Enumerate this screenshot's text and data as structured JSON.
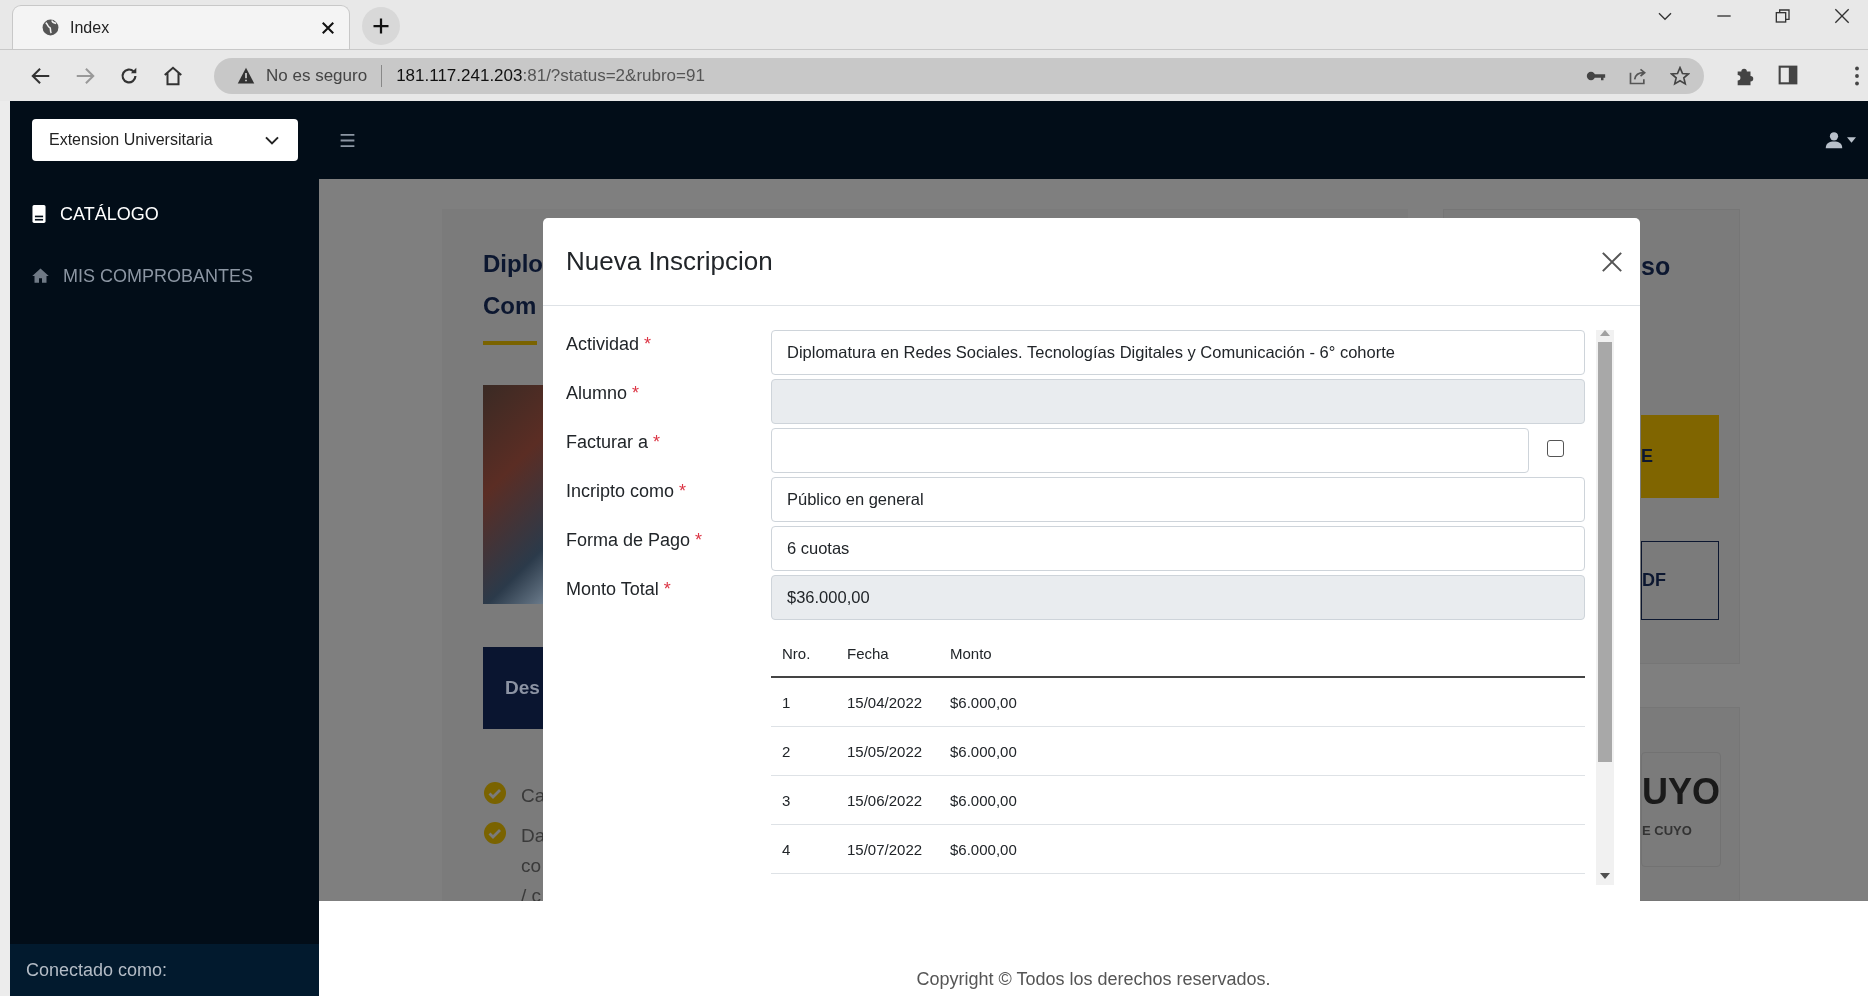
{
  "browser": {
    "tabs": [
      {
        "title": "Index",
        "selected": true
      }
    ],
    "security": "No es seguro",
    "url_host": "181.117.241.203",
    "url_rest": ":81/?status=2&rubro=91"
  },
  "sidebar": {
    "dropdown": "Extension Universitaria",
    "items": [
      {
        "label": "CATÁLOGO",
        "kind": "book",
        "selected": true
      },
      {
        "label": "MIS COMPROBANTES",
        "kind": "home",
        "selected": false
      }
    ],
    "footer": "Conectado como:"
  },
  "background": {
    "title_lines": [
      "Diplo",
      "Com"
    ],
    "dark_button": "Des",
    "checklist": [
      {
        "lines": [
          "Ca"
        ]
      },
      {
        "lines": [
          "Da",
          "co",
          "/ c"
        ]
      }
    ],
    "side_heading": "so",
    "primary_button": "E",
    "pdf_button": "DF",
    "logo_lines": [
      "UYO",
      "E CUYO"
    ]
  },
  "modal": {
    "title": "Nueva Inscripcion",
    "fields": [
      {
        "label": "Actividad",
        "mark": "*",
        "value": "Diplomatura en Redes Sociales. Tecnologías Digitales y Comunicación - 6° cohorte",
        "disabled": false
      },
      {
        "label": "Alumno",
        "mark": "*",
        "disabled": true
      },
      {
        "label": "Facturar a",
        "mark": "*",
        "disabled": false,
        "checkbox": {
          "checked": false
        }
      },
      {
        "label": "Incripto como",
        "mark": "*",
        "value": "Público en general",
        "disabled": false
      },
      {
        "label": "Forma de Pago",
        "mark": "*",
        "value": "6 cuotas",
        "disabled": false
      },
      {
        "label": "Monto Total",
        "mark": "*",
        "value": "$36.000,00",
        "disabled": true
      }
    ],
    "table": {
      "columns": [
        "Nro.",
        "Fecha",
        "Monto"
      ],
      "rows": [
        [
          "1",
          "15/04/2022",
          "$6.000,00"
        ],
        [
          "2",
          "15/05/2022",
          "$6.000,00"
        ],
        [
          "3",
          "15/06/2022",
          "$6.000,00"
        ],
        [
          "4",
          "15/07/2022",
          "$6.000,00"
        ]
      ]
    }
  },
  "footer": "Copyright © Todos los derechos reservados."
}
